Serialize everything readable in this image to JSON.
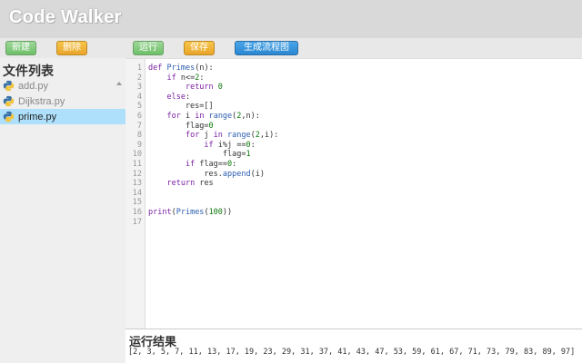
{
  "app": {
    "title": "Code Walker"
  },
  "left_toolbar": {
    "new_label": "新建",
    "delete_label": "删除"
  },
  "right_toolbar": {
    "run_label": "运行",
    "save_label": "保存",
    "flowchart_label": "生成流程图"
  },
  "file_panel": {
    "heading": "文件列表",
    "files": [
      {
        "name": "add.py",
        "active": false
      },
      {
        "name": "Dijkstra.py",
        "active": false
      },
      {
        "name": "prime.py",
        "active": true
      }
    ]
  },
  "editor": {
    "line_numbers": [
      "1",
      "2",
      "3",
      "4",
      "5",
      "6",
      "7",
      "8",
      "9",
      "10",
      "11",
      "12",
      "13",
      "14",
      "15",
      "16",
      "17"
    ],
    "lines": [
      "def Primes(n):",
      "    if n<=2:",
      "        return 0",
      "    else:",
      "        res=[]",
      "    for i in range(2,n):",
      "        flag=0",
      "        for j in range(2,i):",
      "            if i%j ==0:",
      "                flag=1",
      "        if flag==0:",
      "            res.append(i)",
      "    return res",
      "",
      "",
      "print(Primes(100))",
      ""
    ]
  },
  "result": {
    "title": "运行结果",
    "output": "[2, 3, 5, 7, 11, 13, 17, 19, 23, 29, 31, 37, 41, 43, 47, 53, 59, 61, 67, 71, 73, 79, 83, 89, 97]"
  },
  "colors": {
    "topbar": "#d9d9d9",
    "active_file": "#aee0fb",
    "green_button": "#6dbf68",
    "orange_button": "#e9a52a",
    "blue_button": "#2a86d0"
  },
  "icons": {
    "file_icon": "python-icon",
    "scroll_indicator": "scroll-up-icon"
  }
}
